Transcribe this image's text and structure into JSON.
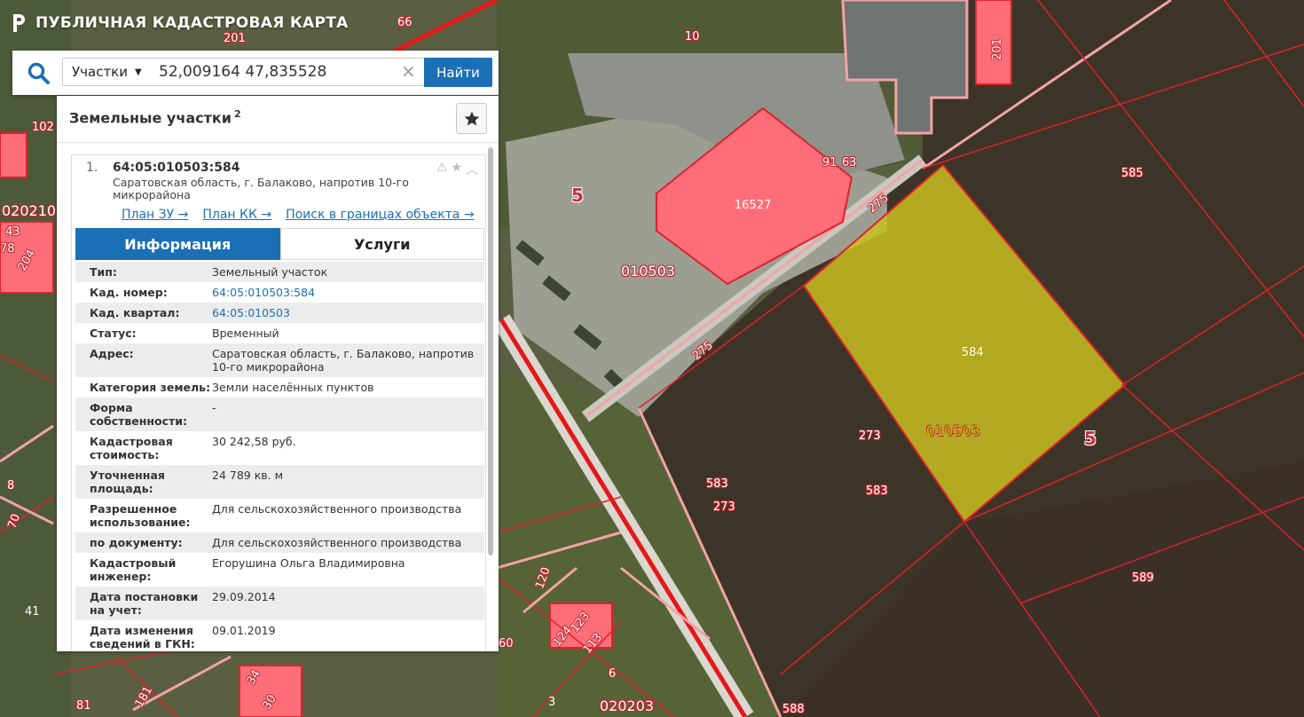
{
  "app": {
    "title": "ПУБЛИЧНАЯ КАДАСТРОВАЯ КАРТА"
  },
  "search": {
    "type_label": "Участки",
    "query": "52,009164 47,835528",
    "button_label": "Найти"
  },
  "panel": {
    "title": "Земельные участки",
    "count": "2",
    "result": {
      "index": "1.",
      "cad_number": "64:05:010503:584",
      "address": "Саратовская область, г. Балаково, напротив 10-го микрорайона",
      "links": [
        "План ЗУ →",
        "План КК →",
        "Поиск в границах объекта →"
      ]
    },
    "tabs": [
      "Информация",
      "Услуги"
    ],
    "info": [
      {
        "label": "Тип:",
        "value": "Земельный участок"
      },
      {
        "label": "Кад. номер:",
        "value": "64:05:010503:584",
        "link": true
      },
      {
        "label": "Кад. квартал:",
        "value": "64:05:010503",
        "link": true
      },
      {
        "label": "Статус:",
        "value": "Временный"
      },
      {
        "label": "Адрес:",
        "value": "Саратовская область, г. Балаково, напротив 10-го микрорайона"
      },
      {
        "label": "Категория земель:",
        "value": "Земли населённых пунктов"
      },
      {
        "label": "Форма собственности:",
        "value": "-"
      },
      {
        "label": "Кадастровая стоимость:",
        "value": "30 242,58 руб."
      },
      {
        "label": "Уточненная площадь:",
        "value": "24 789 кв. м"
      },
      {
        "label": "Разрешенное использование:",
        "value": "Для сельскохозяйственного производства"
      },
      {
        "label": "по документу:",
        "value": "Для сельскохозяйственного производства"
      },
      {
        "label": "Кадастровый инженер:",
        "value": "Егорушина Ольга Владимировна"
      },
      {
        "label": "Дата постановки на учет:",
        "value": "29.09.2014"
      },
      {
        "label": "Дата изменения сведений в ГКН:",
        "value": "09.01.2019"
      }
    ]
  },
  "map_labels": {
    "l_66": "66",
    "l_201a": "201",
    "l_10": "10",
    "l_201b": "201",
    "l_102": "102",
    "l_020210": "020210",
    "l_43": "43",
    "l_78": "78",
    "l_204": "204",
    "l_5a": "5",
    "l_16527": "16527",
    "l_91": "91",
    "l_63": "63",
    "l_275a": "275",
    "l_010503a": "010503",
    "l_585": "585",
    "l_275b": "275",
    "l_584": "584",
    "l_010503b": "010503",
    "l_273a": "273",
    "l_5b": "5",
    "l_583a": "583",
    "l_583b": "583",
    "l_273b": "273",
    "l_589": "589",
    "l_120": "120",
    "l_124": "124",
    "l_123": "123",
    "l_113": "113",
    "l_6": "6",
    "l_41": "41",
    "l_181": "181",
    "l_34": "34",
    "l_3": "3",
    "l_020203": "020203",
    "l_588": "588",
    "l_81": "81",
    "l_70": "70",
    "l_8": "8",
    "l_60": "60",
    "l_30": "30"
  },
  "colors": {
    "accent": "#1b6fb4",
    "parcel_border": "#e0202a",
    "selected_parcel": "#c8c020",
    "building": "#ff6e78"
  }
}
